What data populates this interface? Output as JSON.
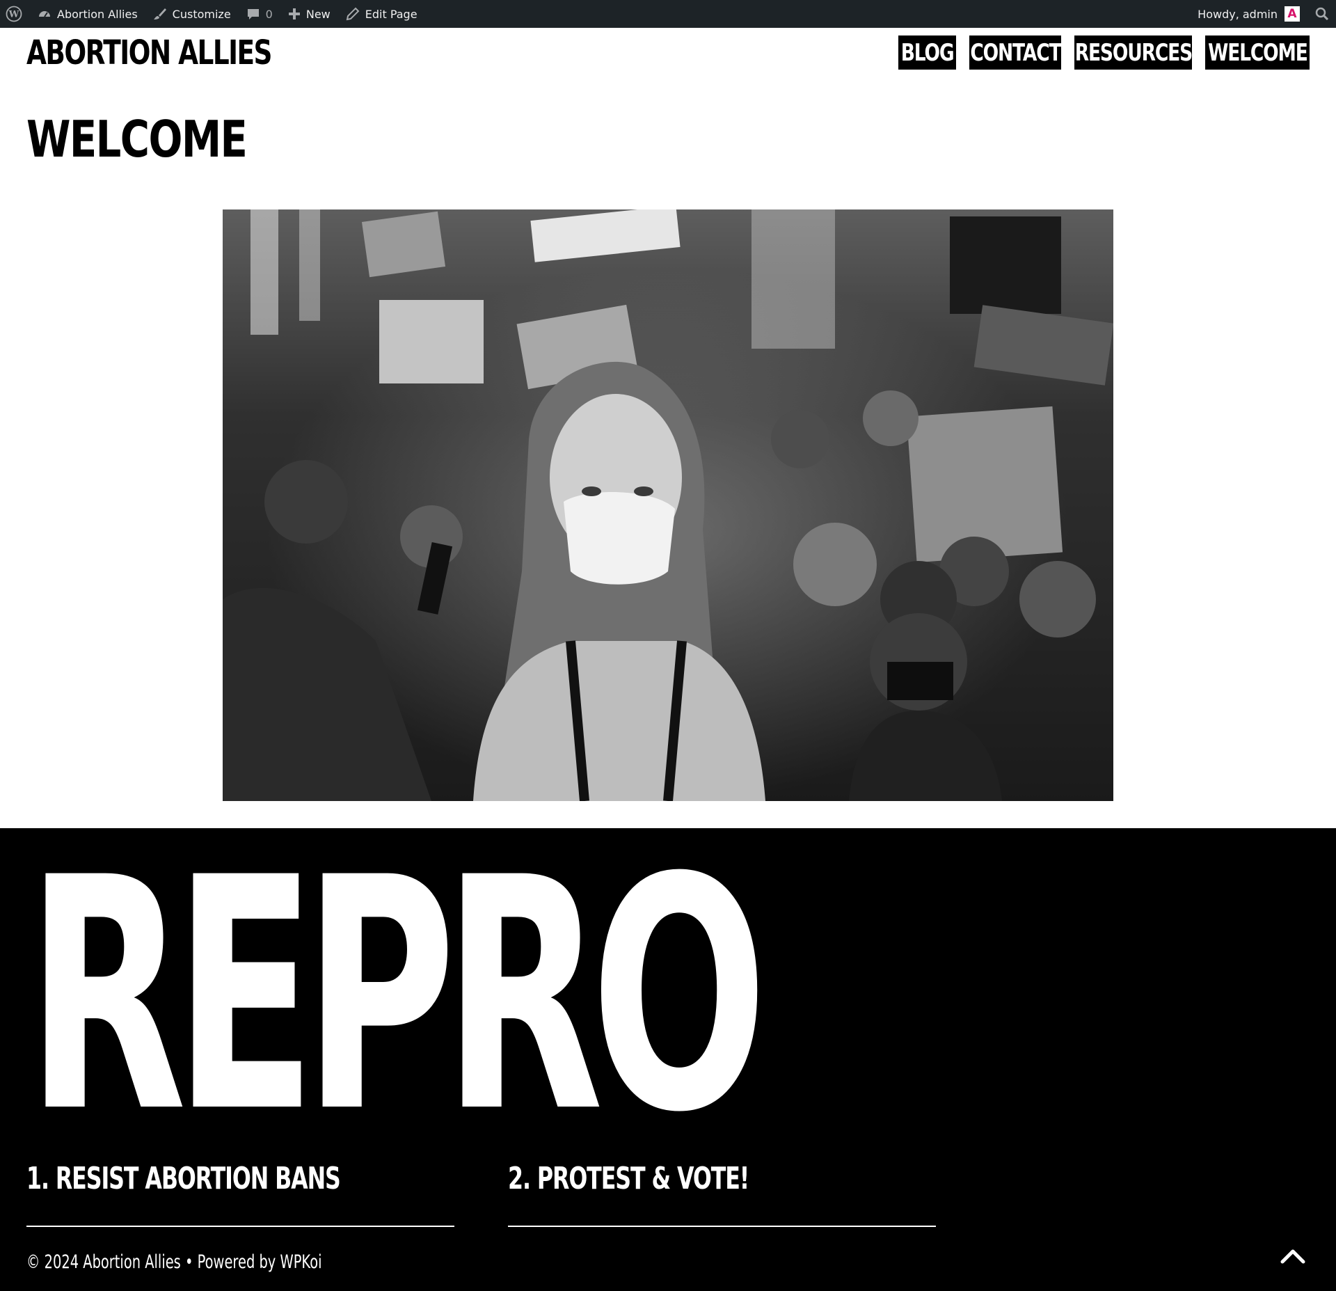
{
  "admin_bar": {
    "site_name": "Abortion Allies",
    "customize_label": "Customize",
    "comments_count": "0",
    "new_label": "New",
    "edit_label": "Edit Page",
    "greeting": "Howdy, admin",
    "avatar_letter": "A"
  },
  "header": {
    "site_title": "ABORTION ALLIES",
    "nav": [
      "BLOG",
      "CONTACT",
      "RESOURCES",
      "WELCOME"
    ]
  },
  "page": {
    "title": "WELCOME"
  },
  "footer": {
    "big_word": "REPRO",
    "col1_heading": "1. RESIST ABORTION BANS",
    "col2_heading": "2. PROTEST & VOTE!",
    "copyright": "© 2024 Abortion Allies • Powered by WPKoi"
  },
  "colors": {
    "admin_bar_bg": "#1d2327",
    "footer_bg": "#000000",
    "avatar_accent": "#d6136a"
  }
}
